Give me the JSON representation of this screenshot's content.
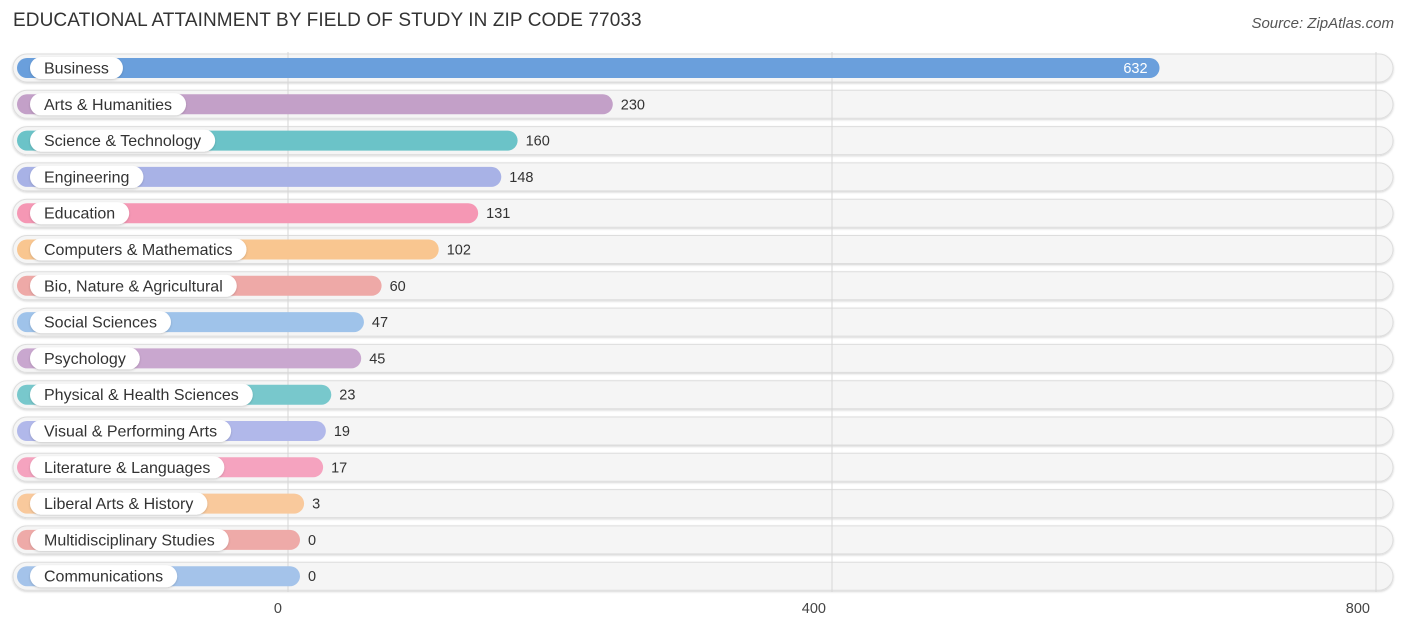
{
  "header": {
    "title": "EDUCATIONAL ATTAINMENT BY FIELD OF STUDY IN ZIP CODE 77033",
    "source": "Source: ZipAtlas.com"
  },
  "chart_data": {
    "type": "bar",
    "orientation": "horizontal",
    "title": "EDUCATIONAL ATTAINMENT BY FIELD OF STUDY IN ZIP CODE 77033",
    "xlabel": "",
    "ylabel": "",
    "xlim": [
      0,
      800
    ],
    "xticks": [
      0,
      400,
      800
    ],
    "xtick_labels": [
      "0",
      "400",
      "800"
    ],
    "grid": true,
    "legend": "none",
    "categories": [
      "Business",
      "Arts & Humanities",
      "Science & Technology",
      "Engineering",
      "Education",
      "Computers & Mathematics",
      "Bio, Nature & Agricultural",
      "Social Sciences",
      "Psychology",
      "Physical & Health Sciences",
      "Visual & Performing Arts",
      "Literature & Languages",
      "Liberal Arts & History",
      "Multidisciplinary Studies",
      "Communications"
    ],
    "values": [
      632,
      230,
      160,
      148,
      131,
      102,
      60,
      47,
      45,
      23,
      19,
      17,
      3,
      0,
      0
    ],
    "value_labels": [
      "632",
      "230",
      "160",
      "148",
      "131",
      "102",
      "60",
      "47",
      "45",
      "23",
      "19",
      "17",
      "3",
      "0",
      "0"
    ],
    "colors": [
      "#6a9fdc",
      "#c3a0c8",
      "#6bc3c8",
      "#a8b2e6",
      "#f597b4",
      "#f9c690",
      "#eea9a7",
      "#9fc3ea",
      "#c9a7cf",
      "#78c8cc",
      "#b1b8ea",
      "#f5a3bf",
      "#f9c99c",
      "#eeaaa8",
      "#a4c3ea"
    ]
  }
}
